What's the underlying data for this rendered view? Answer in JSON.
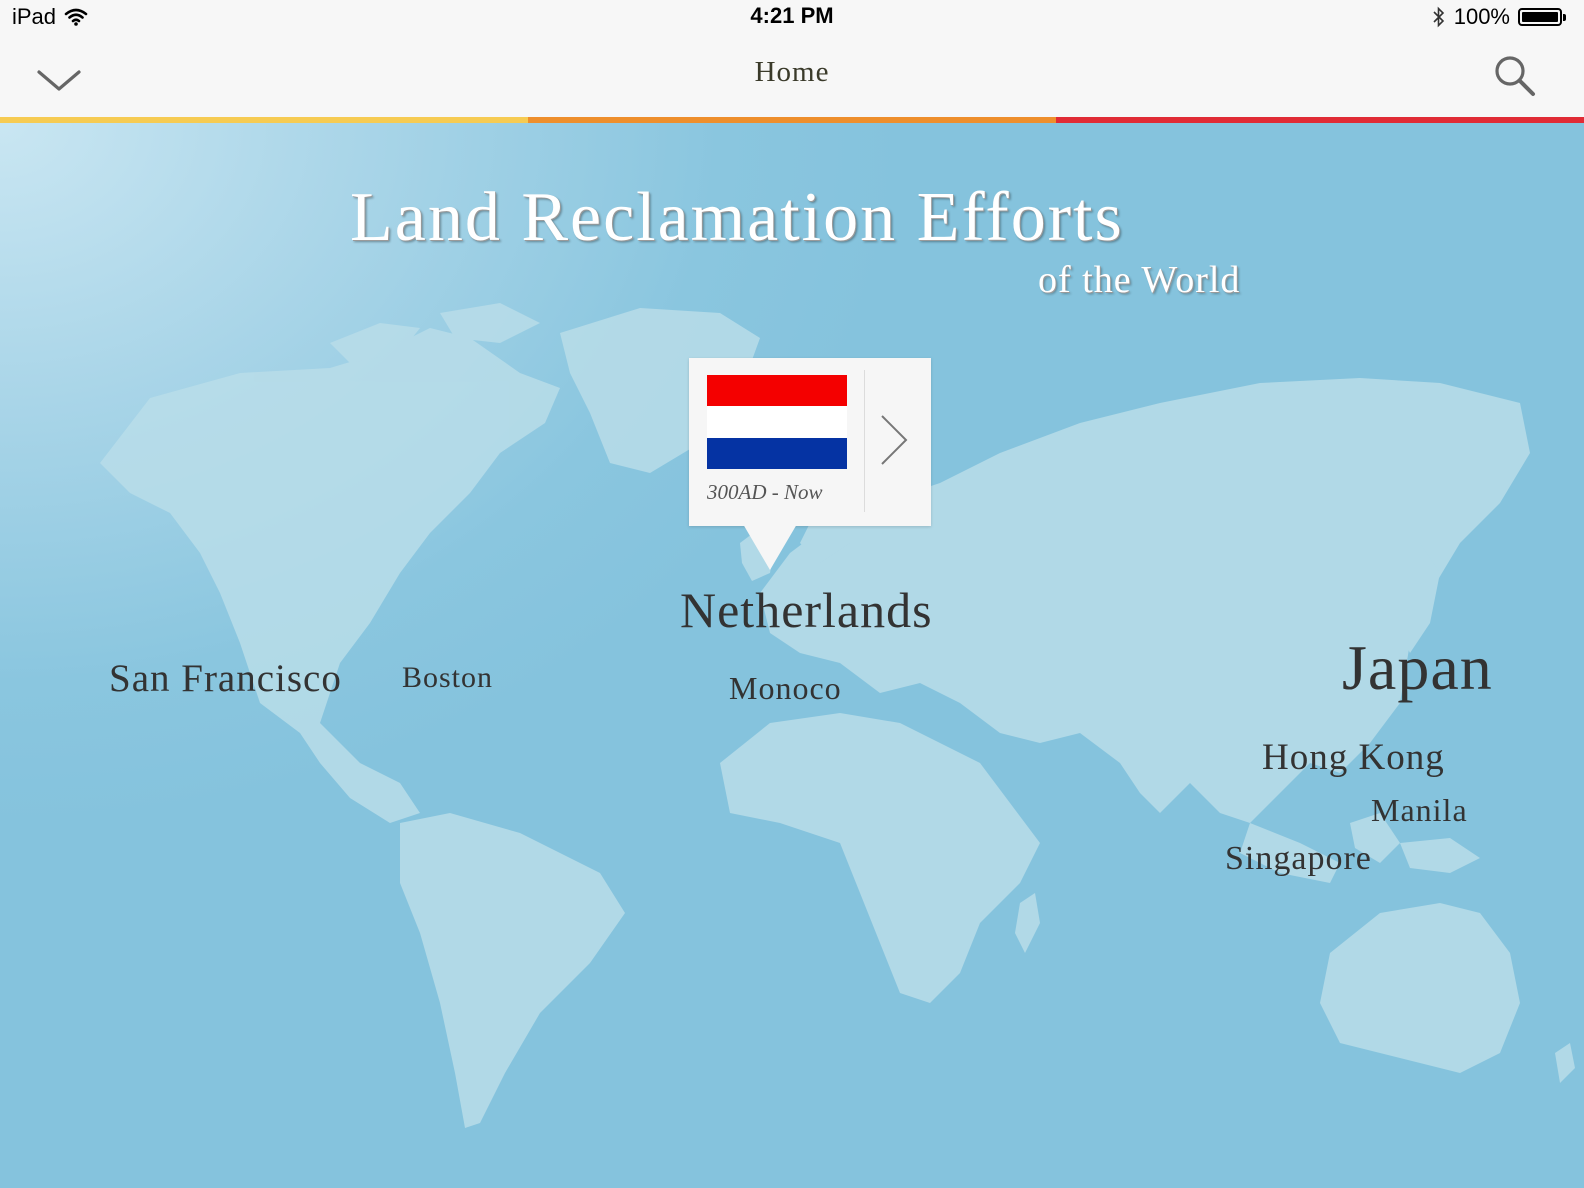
{
  "status_bar": {
    "device": "iPad",
    "time": "4:21 PM",
    "battery": "100%",
    "icons": [
      "wifi-icon",
      "bluetooth-icon",
      "battery-icon"
    ]
  },
  "nav": {
    "title": "Home",
    "menu_icon": "chevron-down-icon",
    "search_icon": "search-icon"
  },
  "accent_colors": {
    "strip": [
      "#f6cb52",
      "#ee8f2c",
      "#e02b35"
    ],
    "map_land": "#b9dde9",
    "flag": [
      "#f40000",
      "#ffffff",
      "#0533a3"
    ]
  },
  "title": {
    "main": "Land Reclamation Efforts",
    "sub": "of the World"
  },
  "callout": {
    "period": "300AD - Now",
    "next_icon": "chevron-right-icon",
    "flag_icon": "netherlands-flag"
  },
  "locations": [
    {
      "name": "Netherlands"
    },
    {
      "name": "San Francisco"
    },
    {
      "name": "Boston"
    },
    {
      "name": "Monoco"
    },
    {
      "name": "Japan"
    },
    {
      "name": "Hong Kong"
    },
    {
      "name": "Manila"
    },
    {
      "name": "Singapore"
    }
  ]
}
